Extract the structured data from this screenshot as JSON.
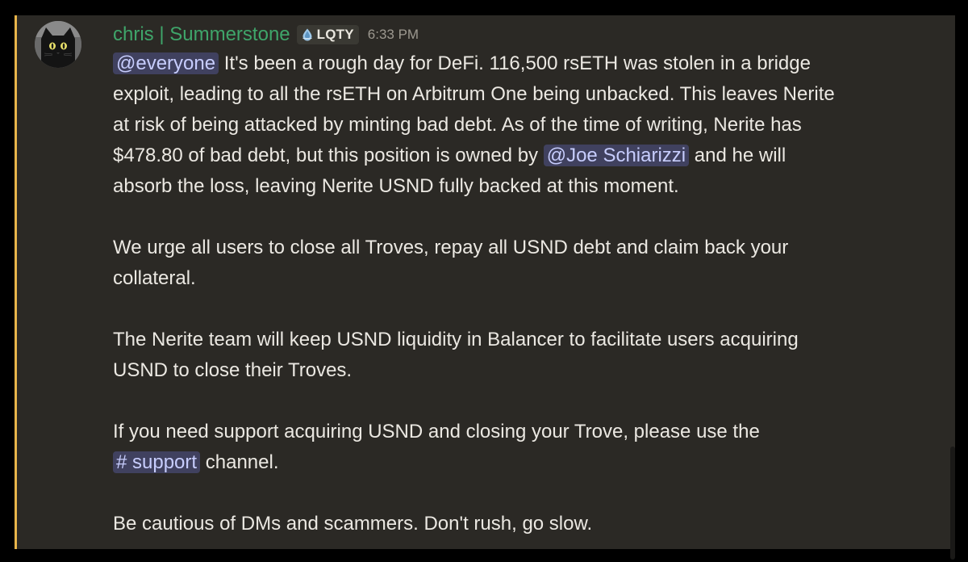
{
  "message": {
    "author": "chris | Summerstone",
    "role_tag": "LQTY",
    "role_icon": "lqty-drop-icon",
    "timestamp": "6:33 PM",
    "avatar_icon": "black-cat-avatar",
    "colors": {
      "author": "#3fa56a",
      "accent_bar": "#e9b54a",
      "mention_bg": "#40415f",
      "mention_text": "#c7cdfd",
      "background": "#2b2925"
    },
    "p1": {
      "mention_everyone": "@everyone",
      "l1_text": " It's been a rough day for DeFi. 116,500 rsETH was stolen in a bridge",
      "l2": "exploit, leading to all the rsETH on Arbitrum One being unbacked. This leaves Nerite",
      "l3": "at risk of being attacked by minting bad debt. As of the time of writing, Nerite has",
      "l4_pre": "$478.80 of bad debt, but this position is owned by ",
      "mention_user": "@Joe Schiarizzi",
      "l4_post": " and he will",
      "l5": "absorb the loss, leaving Nerite USND fully backed at this moment."
    },
    "p2": {
      "l1": "We urge all users to close all Troves, repay all USND debt and claim back your",
      "l2": "collateral."
    },
    "p3": {
      "l1": "The Nerite team will keep USND liquidity in Balancer to facilitate users acquiring",
      "l2": "USND to close their Troves."
    },
    "p4": {
      "l1": "If you need support acquiring USND and closing your Trove, please use the",
      "channel": "# support",
      "l2_post": " channel."
    },
    "p5": {
      "l1": "Be cautious of DMs and scammers. Don't rush, go slow."
    }
  }
}
